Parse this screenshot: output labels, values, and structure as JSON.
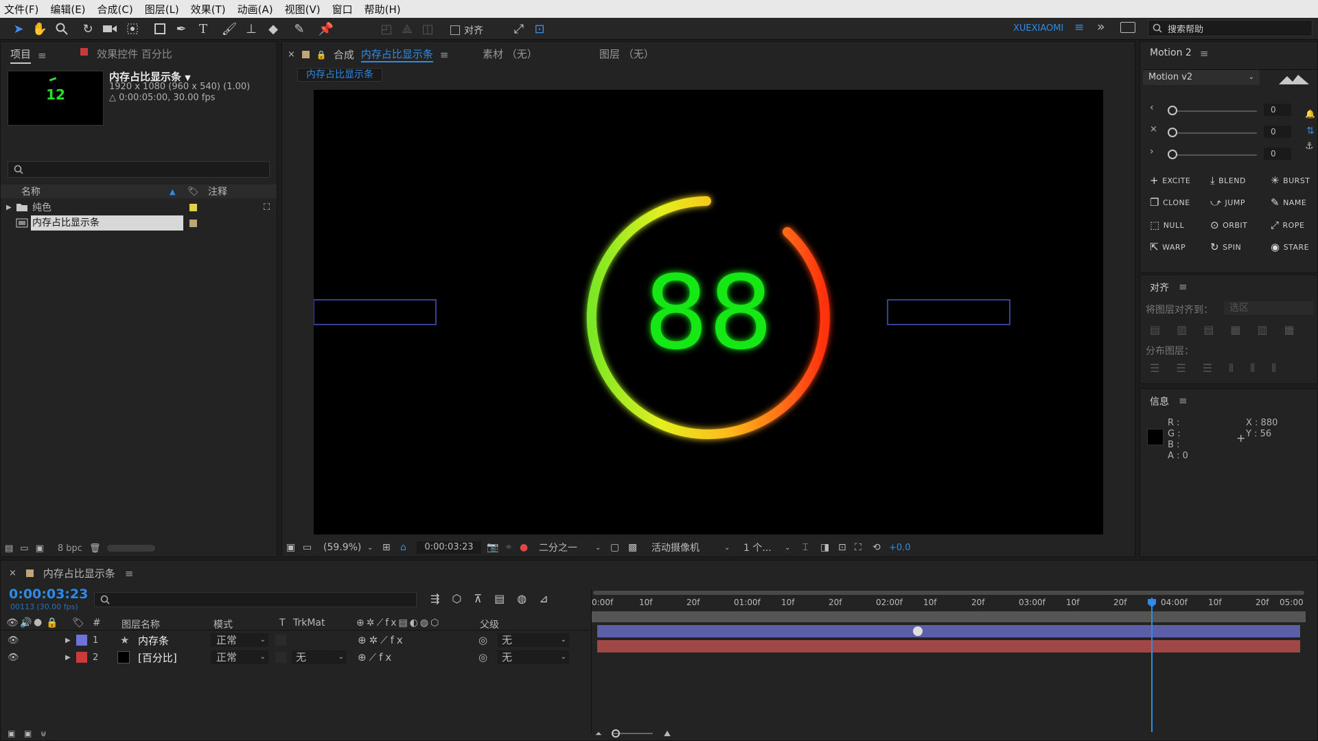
{
  "menu": [
    "文件(F)",
    "编辑(E)",
    "合成(C)",
    "图层(L)",
    "效果(T)",
    "动画(A)",
    "视图(V)",
    "窗口",
    "帮助(H)"
  ],
  "toolbar": {
    "align_label": "对齐",
    "workspace": "XUEXIAOMI",
    "search_placeholder": "搜索帮助"
  },
  "project": {
    "tab_label": "项目",
    "effects_tab": "效果控件 百分比",
    "thumb_number": "12",
    "comp_name": "内存占比显示条",
    "comp_size": "1920 x 1080  (960 x 540) (1.00)",
    "comp_duration": "△ 0:00:05:00, 30.00 fps",
    "col_name": "名称",
    "col_comment": "注释",
    "items": [
      {
        "name": "纯色",
        "type": "folder",
        "label_color": "#e3cf4a"
      },
      {
        "name": "内存占比显示条",
        "type": "comp",
        "label_color": "#bda77a"
      }
    ],
    "bpc": "8 bpc"
  },
  "viewer": {
    "comp_tab_prefix": "合成",
    "comp_tab_name": "内存占比显示条",
    "footage_tab": "素材 （无）",
    "layer_tab": "图层 （无）",
    "breadcrumb": "内存占比显示条",
    "display_number": "88",
    "zoom": "(59.9%)",
    "timecode": "0:00:03:23",
    "resolution": "二分之一",
    "camera": "活动摄像机",
    "views": "1 个...",
    "exposure": "+0.0"
  },
  "motion": {
    "panel_title": "Motion 2",
    "version": "Motion v2",
    "slider_values": [
      "0",
      "0",
      "0"
    ],
    "buttons": [
      "EXCITE",
      "BLEND",
      "BURST",
      "CLONE",
      "JUMP",
      "NAME",
      "NULL",
      "ORBIT",
      "ROPE",
      "WARP",
      "SPIN",
      "STARE"
    ]
  },
  "align": {
    "title": "对齐",
    "align_to_label": "将图层对齐到：",
    "align_to_value": "选区",
    "distribute_label": "分布图层："
  },
  "info": {
    "title": "信息",
    "r": "R :",
    "g": "G :",
    "b": "B :",
    "a": "A : 0",
    "x": "X : 880",
    "y": "Y : 56"
  },
  "timeline": {
    "tab_name": "内存占比显示条",
    "timecode": "0:00:03:23",
    "frame_info": "00113 (30.00 fps)",
    "columns": {
      "num": "#",
      "layer_name": "图层名称",
      "mode": "模式",
      "t": "T",
      "trkmat": "TrkMat",
      "parent": "父级"
    },
    "ruler": [
      "0:00f",
      "10f",
      "20f",
      "01:00f",
      "10f",
      "20f",
      "02:00f",
      "10f",
      "20f",
      "03:00f",
      "10f",
      "20f",
      "04:00f",
      "10f",
      "20f",
      "05:00"
    ],
    "playhead_fraction": 0.7867,
    "layers": [
      {
        "num": "1",
        "name": "内存条",
        "mode": "正常",
        "trkmat": "",
        "parent": "无",
        "label_color": "#6f72d6",
        "bar_color": "#5a5fa8"
      },
      {
        "num": "2",
        "name": "[百分比]",
        "mode": "正常",
        "trkmat": "无",
        "parent": "无",
        "label_color": "#c93b3b",
        "bar_color": "#a04848"
      }
    ]
  }
}
